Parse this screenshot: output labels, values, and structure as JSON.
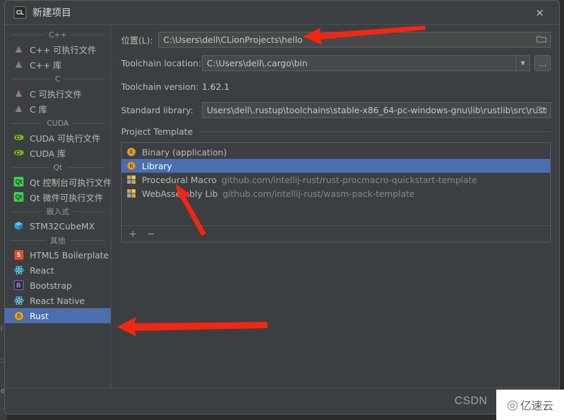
{
  "window": {
    "title": "新建项目",
    "app_icon_text": "CL",
    "close_label": "✕"
  },
  "sidebar": {
    "groups": [
      {
        "label": "C++",
        "items": [
          {
            "label": "C++ 可执行文件",
            "icon": "cpp-triangle-icon",
            "selected": false
          },
          {
            "label": "C++ 库",
            "icon": "cpp-triangle-icon",
            "selected": false
          }
        ]
      },
      {
        "label": "C",
        "items": [
          {
            "label": "C 可执行文件",
            "icon": "c-triangle-icon",
            "selected": false
          },
          {
            "label": "C 库",
            "icon": "c-triangle-icon",
            "selected": false
          }
        ]
      },
      {
        "label": "CUDA",
        "items": [
          {
            "label": "CUDA 可执行文件",
            "icon": "nvidia-icon",
            "selected": false
          },
          {
            "label": "CUDA 库",
            "icon": "nvidia-icon",
            "selected": false
          }
        ]
      },
      {
        "label": "Qt",
        "items": [
          {
            "label": "Qt 控制台可执行文件",
            "icon": "qt-icon",
            "selected": false
          },
          {
            "label": "Qt 微件可执行文件",
            "icon": "qt-icon",
            "selected": false
          }
        ]
      },
      {
        "label": "嵌入式",
        "items": [
          {
            "label": "STM32CubeMX",
            "icon": "cube-icon",
            "selected": false
          }
        ]
      },
      {
        "label": "其他",
        "items": [
          {
            "label": "HTML5 Boilerplate",
            "icon": "html5-icon",
            "selected": false
          },
          {
            "label": "React",
            "icon": "react-icon",
            "selected": false
          },
          {
            "label": "Bootstrap",
            "icon": "bootstrap-icon",
            "selected": false
          },
          {
            "label": "React Native",
            "icon": "react-icon",
            "selected": false
          },
          {
            "label": "Rust",
            "icon": "rust-icon",
            "selected": true
          }
        ]
      }
    ]
  },
  "form": {
    "location_label": "位置(L):",
    "location_value": "C:\\Users\\dell\\CLionProjects\\hello",
    "toolchain_location_label": "Toolchain location:",
    "toolchain_location_value": "C:\\Users\\dell\\.cargo\\bin",
    "toolchain_version_label": "Toolchain version:",
    "toolchain_version_value": "1.62.1",
    "standard_library_label": "Standard library:",
    "standard_library_value": "Users\\dell\\.rustup\\toolchains\\stable-x86_64-pc-windows-gnu\\lib\\rustlib\\src\\rust",
    "ellipsis_button_label": "...",
    "dropdown_arrow": "▼",
    "browse_icon": "folder-icon"
  },
  "project_template": {
    "section_label": "Project Template",
    "items": [
      {
        "label": "Binary (application)",
        "sub": "",
        "icon": "rust-icon",
        "selected": false
      },
      {
        "label": "Library",
        "sub": "",
        "icon": "rust-icon",
        "selected": true
      },
      {
        "label": "Procedural Macro",
        "sub": "github.com/intellij-rust/rust-procmacro-quickstart-template",
        "icon": "puzzle-icon",
        "selected": false
      },
      {
        "label": "WebAssembly Lib",
        "sub": "github.com/intellij-rust/wasm-pack-template",
        "icon": "puzzle-icon",
        "selected": false
      }
    ],
    "add_button_label": "+",
    "remove_button_label": "−"
  },
  "watermark": {
    "csdn_text": "CSDN",
    "logo_glyph": "◎",
    "logo_text": "亿速云"
  },
  "background": {
    "ghost_lines": [
      "i",
      "::",
      "er"
    ]
  },
  "colors": {
    "selection_blue": "#4b6eaf",
    "panel_bg": "#3c3f41",
    "field_bg": "#45494a",
    "annotation_red": "#f22613"
  }
}
